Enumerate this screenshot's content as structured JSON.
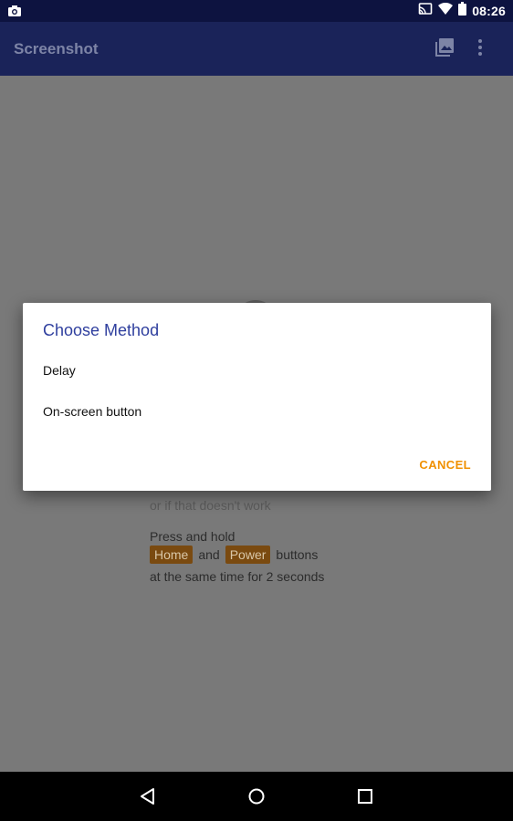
{
  "status_bar": {
    "time": "08:26",
    "icons": [
      "camera-icon",
      "cast-icon",
      "wifi-icon",
      "battery-icon"
    ]
  },
  "app_bar": {
    "title": "Screenshot",
    "actions": [
      "gallery-icon",
      "more-vert-icon"
    ]
  },
  "background": {
    "alt_text": "or if that doesn't work",
    "press_text": "Press and hold",
    "key_home": "Home",
    "and_text": "and",
    "key_power": "Power",
    "buttons_text": "buttons",
    "duration_text": "at the same time for 2 seconds"
  },
  "dialog": {
    "title": "Choose Method",
    "options": [
      "Delay",
      "On-screen button"
    ],
    "cancel_label": "CANCEL"
  },
  "nav_bar": {
    "buttons": [
      "back-icon",
      "home-icon",
      "recents-icon"
    ]
  },
  "colors": {
    "status_bar": "#0d1340",
    "app_bar": "#1a2359",
    "accent": "#f09000",
    "dialog_title": "#2f3f9e"
  }
}
